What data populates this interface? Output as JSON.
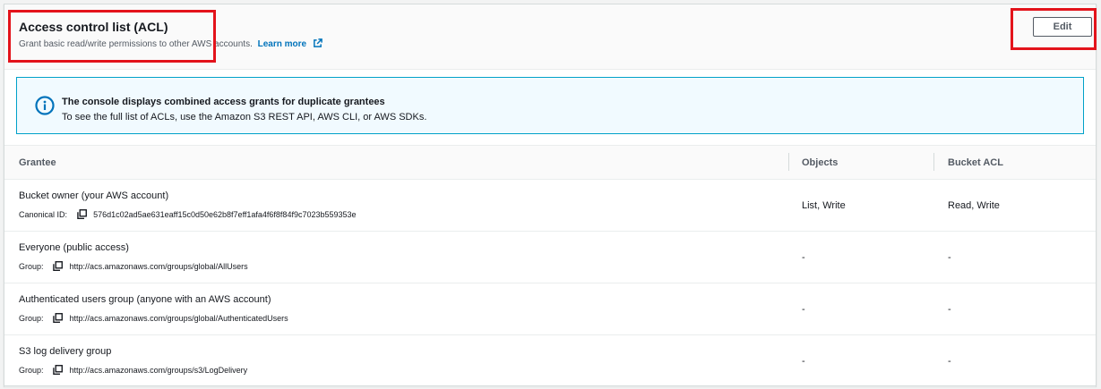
{
  "header": {
    "title": "Access control list (ACL)",
    "description": "Grant basic read/write permissions to other AWS accounts.",
    "learn_more": "Learn more",
    "edit_label": "Edit"
  },
  "info": {
    "title": "The console displays combined access grants for duplicate grantees",
    "body": "To see the full list of ACLs, use the Amazon S3 REST API, AWS CLI, or AWS SDKs."
  },
  "table": {
    "columns": [
      "Grantee",
      "Objects",
      "Bucket ACL"
    ],
    "rows": [
      {
        "grantee": "Bucket owner (your AWS account)",
        "id_label": "Canonical ID:",
        "id_value": "576d1c02ad5ae631eaff15c0d50e62b8f7eff1afa4f6f8f84f9c7023b559353e",
        "objects": "List, Write",
        "bucket_acl": "Read, Write"
      },
      {
        "grantee": "Everyone (public access)",
        "id_label": "Group:",
        "id_value": "http://acs.amazonaws.com/groups/global/AllUsers",
        "objects": "-",
        "bucket_acl": "-"
      },
      {
        "grantee": "Authenticated users group (anyone with an AWS account)",
        "id_label": "Group:",
        "id_value": "http://acs.amazonaws.com/groups/global/AuthenticatedUsers",
        "objects": "-",
        "bucket_acl": "-"
      },
      {
        "grantee": "S3 log delivery group",
        "id_label": "Group:",
        "id_value": "http://acs.amazonaws.com/groups/s3/LogDelivery",
        "objects": "-",
        "bucket_acl": "-"
      }
    ]
  },
  "colors": {
    "link": "#0073bb",
    "info_border": "#00a1c9",
    "highlight": "#e3131b"
  },
  "icons": {
    "info": "info-circle-icon",
    "external": "external-link-icon",
    "copy": "copy-icon"
  }
}
